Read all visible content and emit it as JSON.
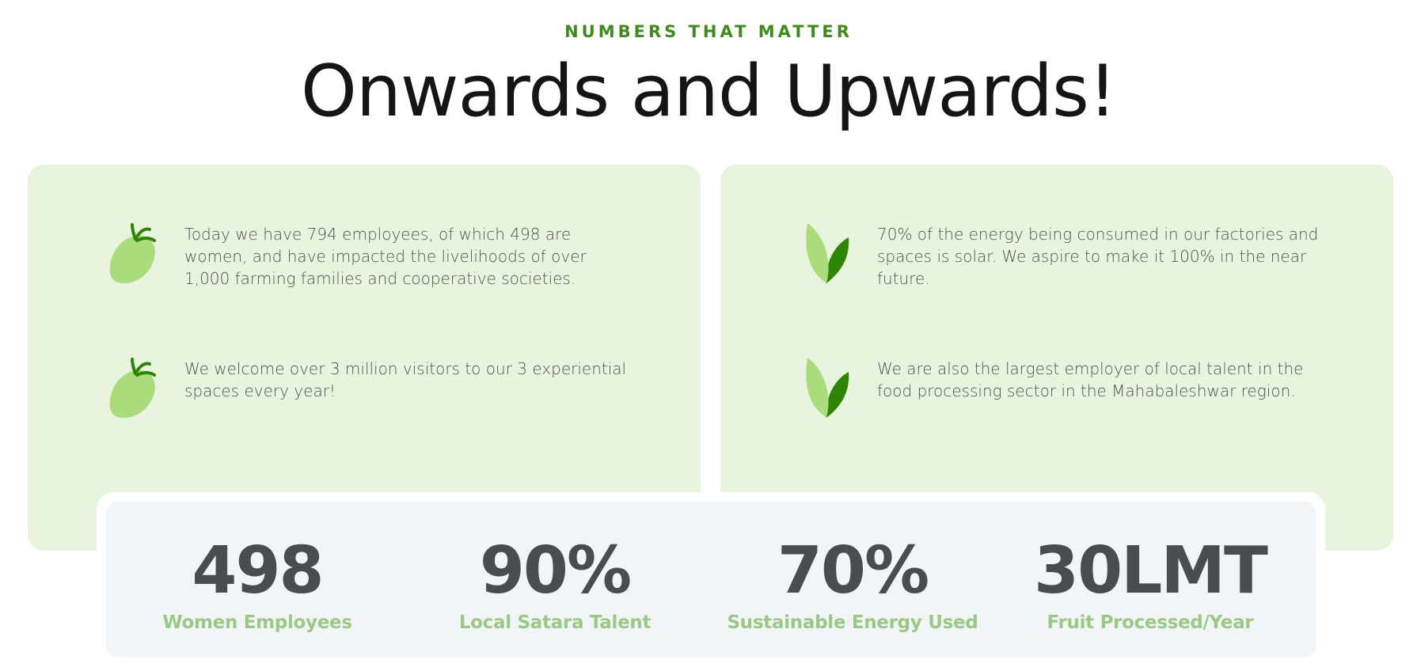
{
  "header": {
    "eyebrow": "NUMBERS THAT MATTER",
    "title": "Onwards and Upwards!"
  },
  "left_card": {
    "items": [
      {
        "icon": "strawberry-icon",
        "text": "Today we have 794 employees, of which 498 are women, and have impacted the livelihoods of over 1,000 farming families and cooperative societies."
      },
      {
        "icon": "strawberry-icon",
        "text": "We welcome over 3 million visitors to our 3 experiential spaces every year!"
      }
    ]
  },
  "right_card": {
    "items": [
      {
        "icon": "leaf-icon",
        "text": "70% of the energy being consumed in our factories and spaces is solar. We aspire to make it 100% in the near future."
      },
      {
        "icon": "leaf-icon",
        "text": "We are also the largest employer of local talent in the food processing sector in the Mahabaleshwar region."
      }
    ]
  },
  "stats": [
    {
      "value": "498",
      "label": "Women Employees"
    },
    {
      "value": "90%",
      "label": "Local Satara Talent"
    },
    {
      "value": "70%",
      "label": "Sustainable Energy Used"
    },
    {
      "value": "30LMT",
      "label": "Fruit Processed/Year"
    }
  ],
  "colors": {
    "accent_green": "#3e8a1a",
    "card_background": "#e9f4de",
    "icon_light_green": "#aadc7c",
    "icon_dark_green": "#2e8505",
    "stat_label_green": "#9cc885",
    "stat_number": "#484d52",
    "stats_background": "#f1f5f8"
  }
}
